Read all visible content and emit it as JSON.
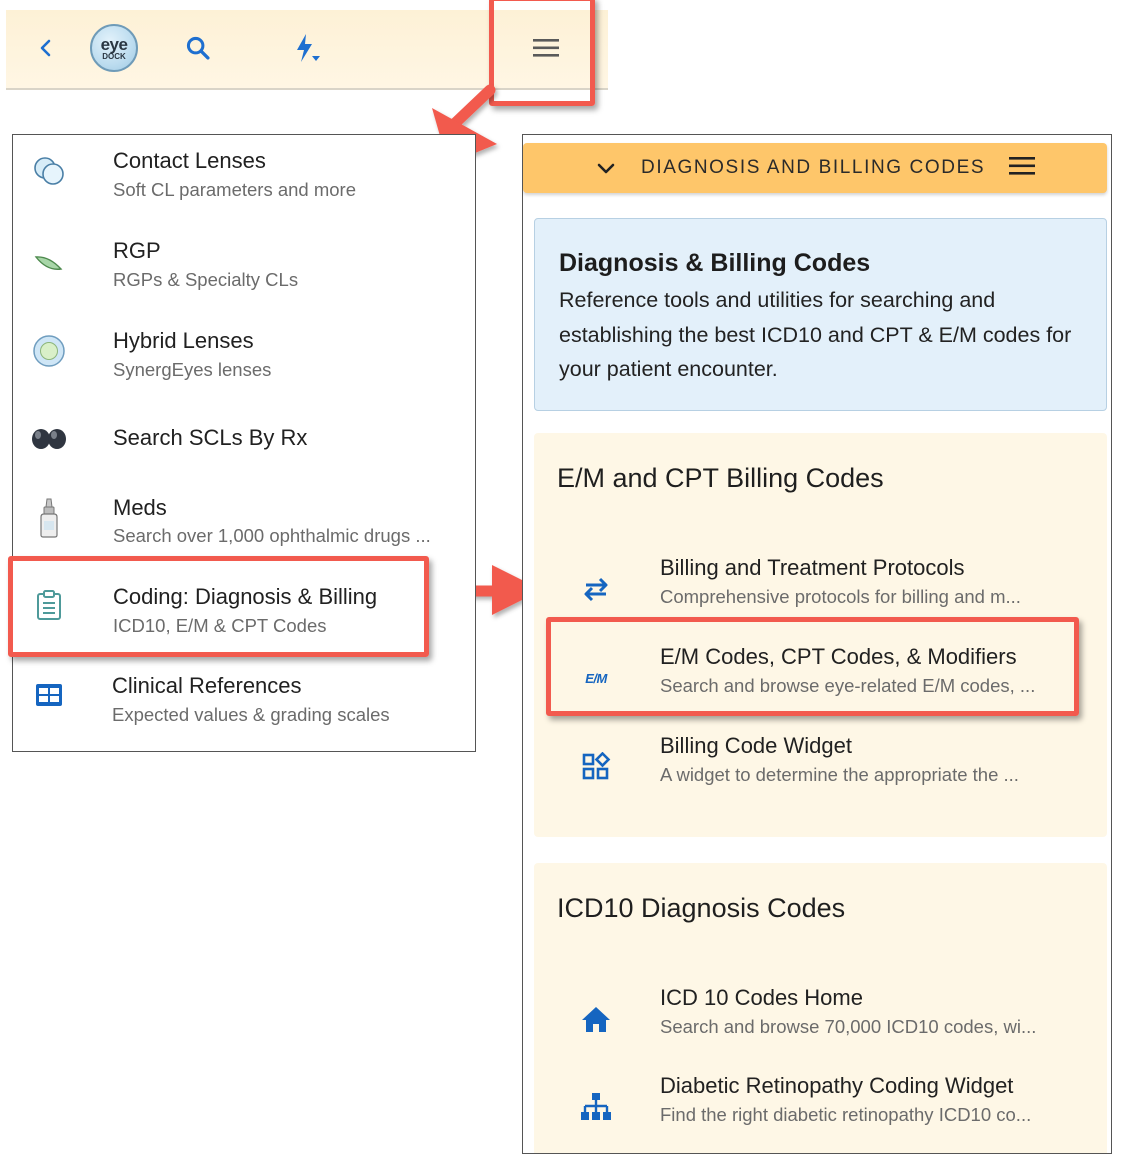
{
  "topbar": {
    "logo_line1": "eye",
    "logo_line2": "DOCK",
    "icons": [
      "back-chevron-icon",
      "search-icon",
      "flash-dropdown-icon",
      "hamburger-menu-icon"
    ]
  },
  "menu": {
    "items": [
      {
        "title": "Contact Lenses",
        "subtitle": "Soft CL parameters and more",
        "icon": "contact-lenses-icon"
      },
      {
        "title": "RGP",
        "subtitle": "RGPs & Specialty CLs",
        "icon": "rgp-lens-icon"
      },
      {
        "title": "Hybrid Lenses",
        "subtitle": "SynergEyes lenses",
        "icon": "hybrid-lens-icon"
      },
      {
        "title": "Search SCLs By Rx",
        "subtitle": "",
        "icon": "lens-pair-icon"
      },
      {
        "title": "Meds",
        "subtitle": "Search over 1,000 ophthalmic drugs ...",
        "icon": "eye-drop-bottle-icon"
      },
      {
        "title": "Coding: Diagnosis & Billing",
        "subtitle": "ICD10, E/M & CPT Codes",
        "icon": "clipboard-icon"
      },
      {
        "title": "Clinical References",
        "subtitle": "Expected values & grading scales",
        "icon": "table-icon"
      }
    ]
  },
  "panel": {
    "header_title": "DIAGNOSIS AND BILLING CODES",
    "info": {
      "title": "Diagnosis & Billing Codes",
      "body": "Reference tools and utilities for searching and establishing the best ICD10 and CPT & E/M codes for your patient encounter."
    },
    "sections": [
      {
        "title": "E/M and CPT Billing Codes",
        "items": [
          {
            "title": "Billing and Treatment Protocols",
            "subtitle": "Comprehensive protocols for billing and m...",
            "icon": "swap-arrows-icon"
          },
          {
            "title": "E/M Codes, CPT Codes, & Modifiers",
            "subtitle": "Search and browse eye-related E/M codes, ...",
            "icon": "em-badge-icon",
            "icon_text": "E/M"
          },
          {
            "title": "Billing Code Widget",
            "subtitle": "A widget to determine the appropriate the ...",
            "icon": "widgets-icon"
          }
        ]
      },
      {
        "title": "ICD10 Diagnosis Codes",
        "items": [
          {
            "title": "ICD 10 Codes Home",
            "subtitle": "Search and browse 70,000 ICD10 codes, wi...",
            "icon": "home-icon"
          },
          {
            "title": "Diabetic Retinopathy Coding Widget",
            "subtitle": "Find the right diabetic retinopathy ICD10 co...",
            "icon": "hierarchy-icon"
          }
        ]
      }
    ]
  },
  "colors": {
    "accent_blue": "#1565c0",
    "header_yellow": "#fec66a",
    "callout_red": "#f25a4e",
    "info_blue": "#e3f0fa",
    "section_cream": "#fef7e6"
  }
}
